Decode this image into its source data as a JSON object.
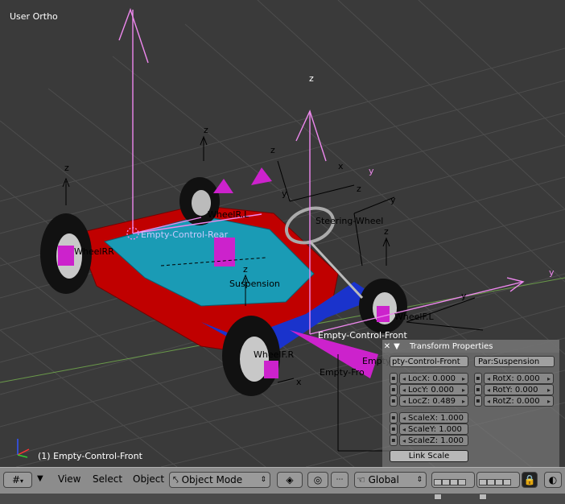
{
  "viewport": {
    "view_name": "User Ortho",
    "status": "(1) Empty-Control-Front"
  },
  "scene_labels": {
    "empty_rear": "Empty-Control-Rear",
    "empty_front": "Empty-Control-Front",
    "empty_front2": "Empty-Fro",
    "empty_front3": "Empty",
    "suspension": "Suspension",
    "steering": "Steering-Wheel",
    "wheel_rr": "WheelRR",
    "wheel_rl": "WheelR.L",
    "wheel_fl": "WheelF.L",
    "wheel_fr": "WheelF.R",
    "axis_z": "z",
    "axis_y": "y",
    "axis_x": "x"
  },
  "transform_panel": {
    "title": "Transform Properties",
    "object_name": "pty-Control-Front",
    "parent": "Par:Suspension",
    "loc": [
      {
        "label": "LocX: 0.000"
      },
      {
        "label": "LocY: 0.000"
      },
      {
        "label": "LocZ: 0.489"
      }
    ],
    "rot": [
      {
        "label": "RotX: 0.000"
      },
      {
        "label": "RotY: 0.000"
      },
      {
        "label": "RotZ: 0.000"
      }
    ],
    "scale": [
      {
        "label": "ScaleX: 1.000"
      },
      {
        "label": "ScaleY: 1.000"
      },
      {
        "label": "ScaleZ: 1.000"
      }
    ],
    "link_scale": "Link Scale"
  },
  "header": {
    "menus": [
      "View",
      "Select",
      "Object"
    ],
    "mode": "Object Mode",
    "orientation": "Global"
  },
  "colors": {
    "car_body": "#c00000",
    "platform": "#1a9bb5",
    "empty": "#ee88ee",
    "wheel": "#111111",
    "rim": "#cccccc",
    "hub": "#cc22cc"
  }
}
